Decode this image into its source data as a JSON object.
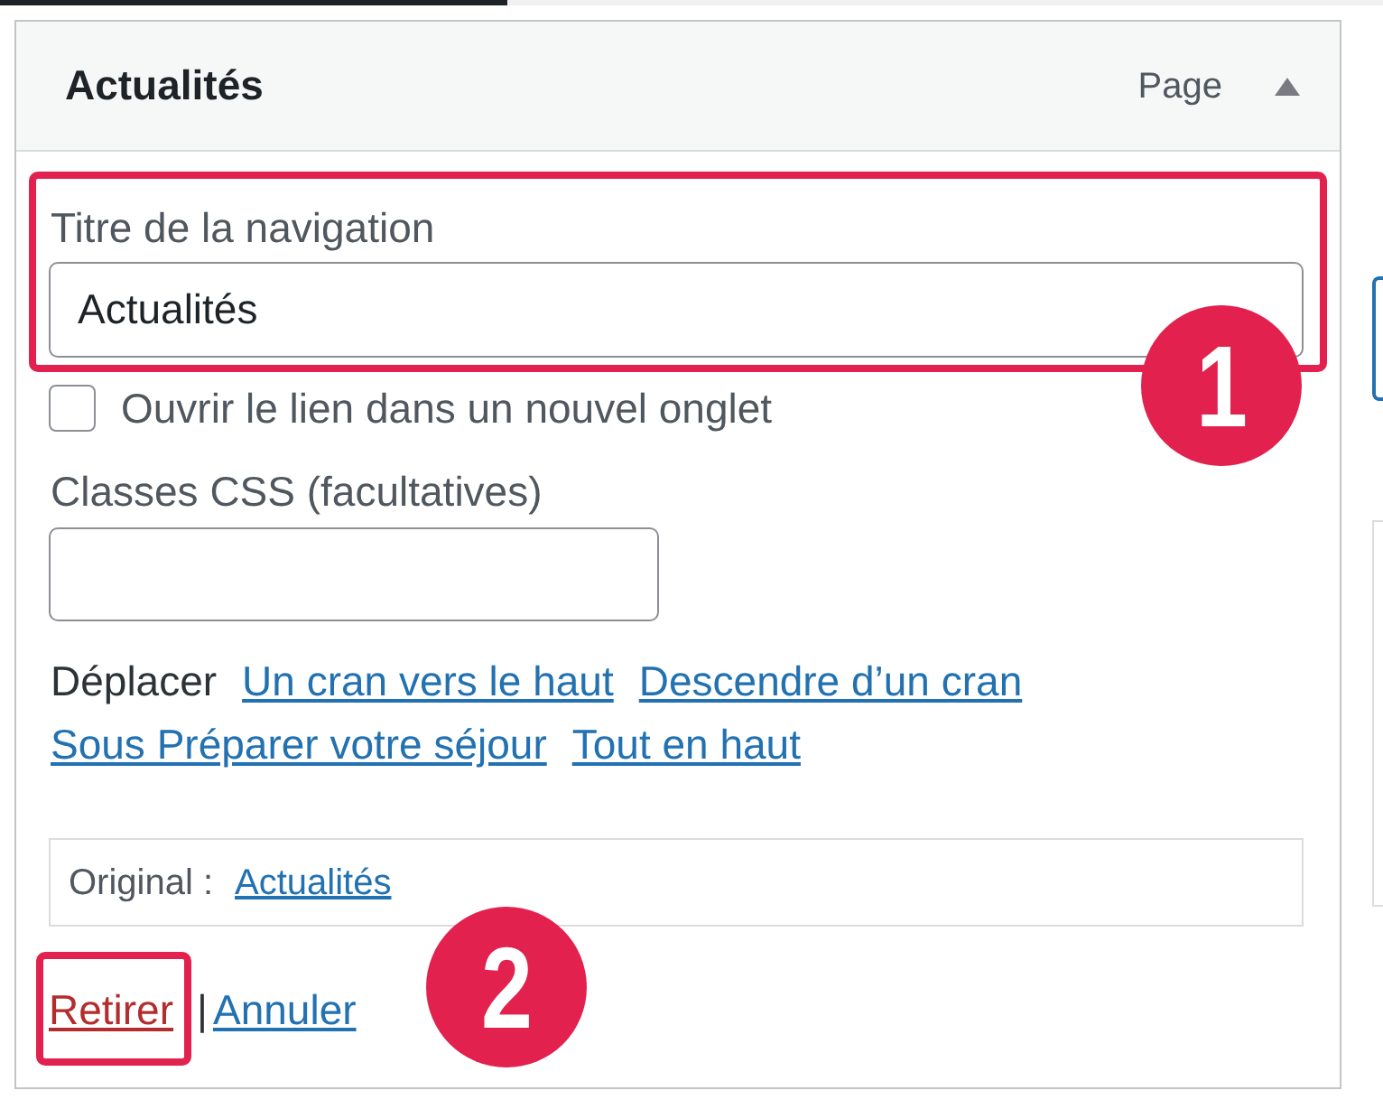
{
  "item": {
    "title": "Actualités",
    "type_label": "Page",
    "expanded": true
  },
  "navigation_label": {
    "label": "Titre de la navigation",
    "value": "Actualités",
    "highlighted": true
  },
  "open_in_new_tab": {
    "label": "Ouvrir le lien dans un nouvel onglet",
    "checked": false
  },
  "css_classes": {
    "label": "Classes CSS (facultatives)"
  },
  "move": {
    "label": "Déplacer",
    "links": [
      "Un cran vers le haut",
      "Descendre d’un cran",
      "Sous Préparer votre séjour",
      "Tout en haut"
    ]
  },
  "original": {
    "label": "Original :",
    "link": "Actualités"
  },
  "actions": [
    {
      "label": "Retirer",
      "kind": "delete",
      "highlighted": true
    },
    {
      "label": "Annuler",
      "kind": "cancel",
      "highlighted": false
    }
  ],
  "action_separator": "|",
  "callouts": [
    {
      "number": "1"
    },
    {
      "number": "2"
    }
  ]
}
